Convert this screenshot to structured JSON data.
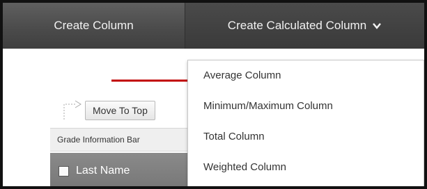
{
  "toolbar": {
    "create_column": "Create Column",
    "create_calculated_column": "Create Calculated Column"
  },
  "menu": {
    "items": [
      {
        "label": "Average Column"
      },
      {
        "label": "Minimum/Maximum Column"
      },
      {
        "label": "Total Column"
      },
      {
        "label": "Weighted Column"
      }
    ]
  },
  "content": {
    "move_to_top": "Move To Top",
    "grade_information_bar": "Grade Information Bar",
    "last_name": "Last Name"
  },
  "colors": {
    "arrow": "#c00000"
  },
  "icons": {
    "chevron": "chevron-down-icon",
    "move_arrow": "move-to-top-arrow-icon",
    "annotation_arrow": "red-arrow-icon"
  }
}
